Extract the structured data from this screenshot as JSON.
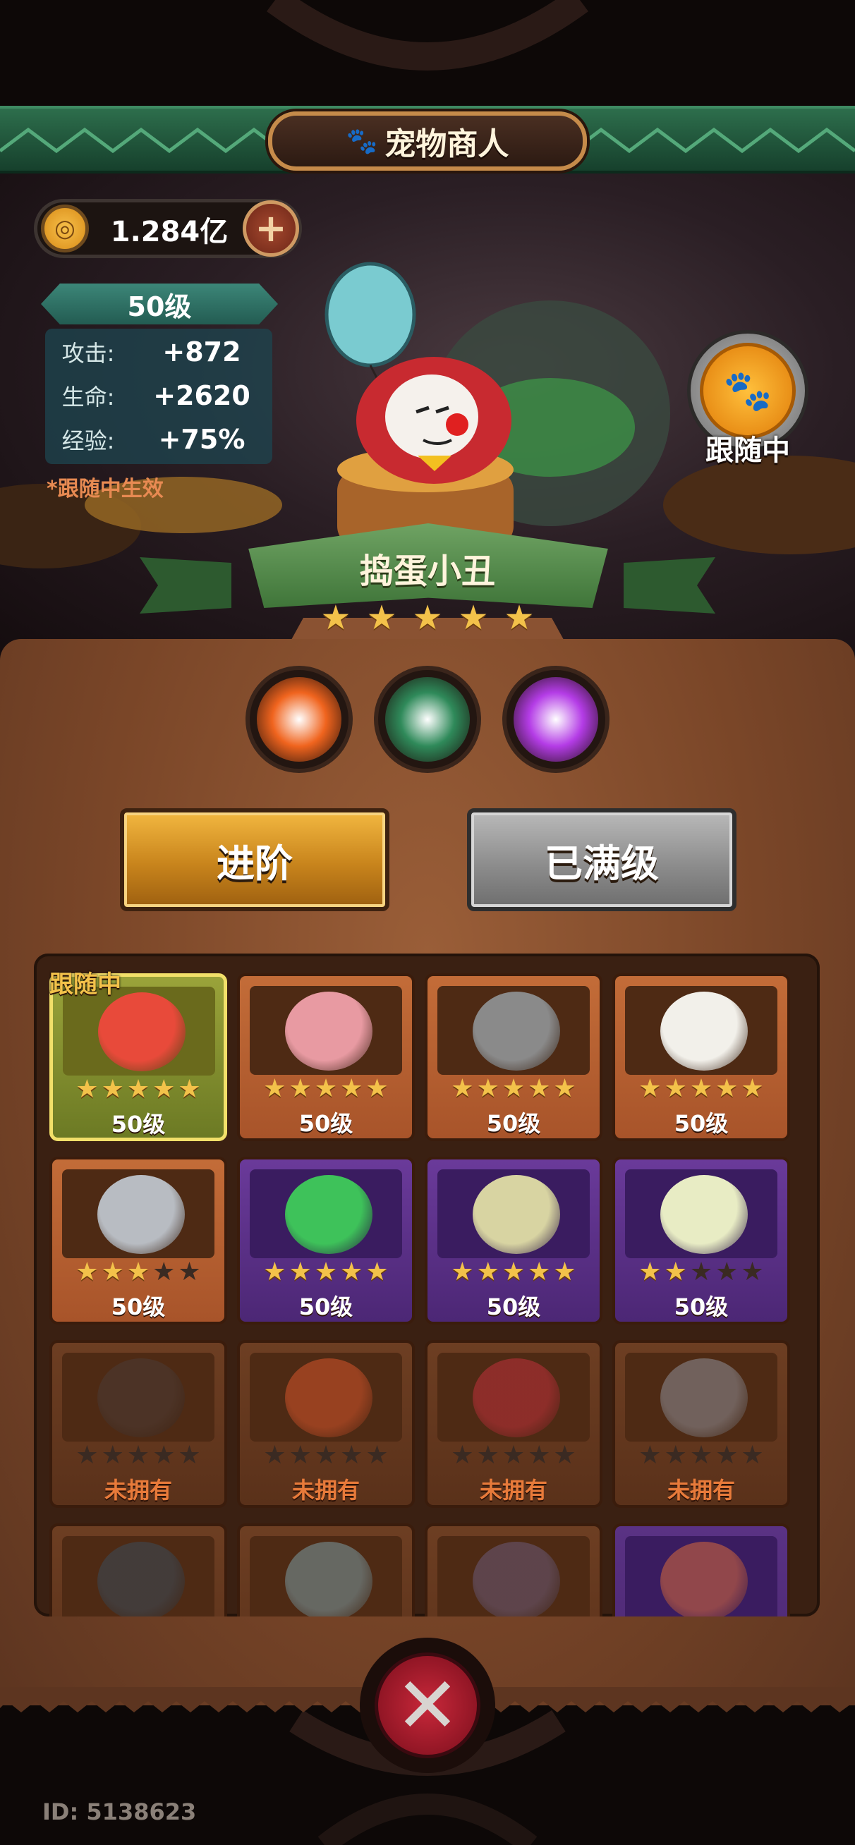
{
  "header": {
    "title": "宠物商人",
    "icon": "paw-icon"
  },
  "currency": {
    "icon": "coin-icon",
    "value": "1.284亿",
    "add_icon": "plus-icon"
  },
  "stats": {
    "level": "50级",
    "rows": [
      {
        "key": "攻击:",
        "value": "+872"
      },
      {
        "key": "生命:",
        "value": "+2620"
      },
      {
        "key": "经验:",
        "value": "+75%"
      }
    ],
    "hint": "*跟随中生效"
  },
  "follow": {
    "label": "跟随中",
    "icon": "paw-icon"
  },
  "pet": {
    "name": "捣蛋小丑",
    "stars": 5,
    "max_stars": 5
  },
  "skills": [
    {
      "icon": "fireball-skill-icon",
      "color": "#f0641e"
    },
    {
      "icon": "claw-skill-icon",
      "color": "#2f8a5a"
    },
    {
      "icon": "chat-bubble-skill-icon",
      "color": "#b43ce6"
    }
  ],
  "buttons": {
    "advance": "进阶",
    "max_level": "已满级"
  },
  "grid": {
    "follow_tag": "跟随中",
    "cards": [
      {
        "name": "clown",
        "stars": 5,
        "label": "50级",
        "theme": "selected",
        "color": "#e84a3a",
        "owned": true
      },
      {
        "name": "pink-bear",
        "stars": 5,
        "label": "50级",
        "theme": "orange",
        "color": "#e89aa2",
        "owned": true
      },
      {
        "name": "robot-kid",
        "stars": 5,
        "label": "50级",
        "theme": "orange",
        "color": "#8a8a8a",
        "owned": true
      },
      {
        "name": "samurai-goose",
        "stars": 5,
        "label": "50级",
        "theme": "orange",
        "color": "#f2f0ea",
        "owned": true
      },
      {
        "name": "knight",
        "stars": 3,
        "label": "50级",
        "theme": "orange",
        "color": "#b8bcc2",
        "owned": true
      },
      {
        "name": "green-frog",
        "stars": 5,
        "label": "50级",
        "theme": "purple",
        "color": "#3ec25a",
        "owned": true
      },
      {
        "name": "owl-mask",
        "stars": 5,
        "label": "50级",
        "theme": "purple",
        "color": "#d8d4a2",
        "owned": true
      },
      {
        "name": "egg-chick",
        "stars": 2,
        "label": "50级",
        "theme": "purple",
        "color": "#e8ecc4",
        "owned": true
      },
      {
        "name": "chomper",
        "stars": 0,
        "label": "未拥有",
        "theme": "locked",
        "color": "#4a3a34",
        "owned": false
      },
      {
        "name": "fire-dragon",
        "stars": 0,
        "label": "未拥有",
        "theme": "locked",
        "color": "#d4542a",
        "owned": false
      },
      {
        "name": "daruma",
        "stars": 0,
        "label": "未拥有",
        "theme": "locked",
        "color": "#c0303a",
        "owned": false
      },
      {
        "name": "metal-gauntlet",
        "stars": 0,
        "label": "未拥有",
        "theme": "locked",
        "color": "#8e8e96",
        "owned": false
      },
      {
        "name": "raven",
        "stars": 0,
        "label": "",
        "theme": "locked",
        "color": "#3a4a58",
        "owned": false
      },
      {
        "name": "stone-golem",
        "stars": 0,
        "label": "",
        "theme": "locked",
        "color": "#7a9aa2",
        "owned": false
      },
      {
        "name": "cat-ninja",
        "stars": 0,
        "label": "",
        "theme": "locked",
        "color": "#6a5a78",
        "owned": false
      },
      {
        "name": "rooster",
        "stars": 0,
        "label": "",
        "theme": "locked purple",
        "color": "#d86a3a",
        "owned": false
      }
    ]
  },
  "close": {
    "icon": "close-icon"
  },
  "footer": {
    "user_id": "ID: 5138623"
  }
}
